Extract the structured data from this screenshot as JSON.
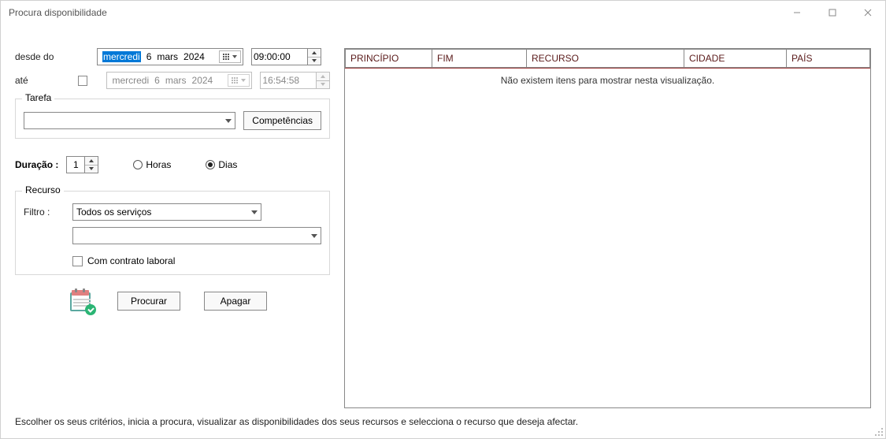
{
  "window": {
    "title": "Procura disponibilidade"
  },
  "labels": {
    "from": "desde do",
    "to": "até",
    "task_group": "Tarefa",
    "competencies_btn": "Competências",
    "duration": "Duração :",
    "hours": "Horas",
    "days": "Dias",
    "resource_group": "Recurso",
    "filter": "Filtro :",
    "contract": "Com contrato laboral",
    "search_btn": "Procurar",
    "clear_btn": "Apagar"
  },
  "date_from": {
    "weekday": "mercredi",
    "day": "6",
    "month": "mars",
    "year": "2024",
    "enabled": true
  },
  "date_to": {
    "weekday": "mercredi",
    "day": "6",
    "month": "mars",
    "year": "2024",
    "enabled": false
  },
  "time_from": "09:00:00",
  "time_to": "16:54:58",
  "to_checked": false,
  "task_value": "",
  "duration_value": "1",
  "duration_unit": "days",
  "filter_value": "Todos os serviços",
  "sub_filter_value": "",
  "contract_checked": false,
  "table": {
    "columns": [
      "PRINCÍPIO",
      "FIM",
      "RECURSO",
      "CIDADE",
      "PAÍS"
    ],
    "empty_message": "Não existem itens para mostrar nesta visualização."
  },
  "footer": "Escolher os seus critérios, inicia a procura, visualizar as disponibilidades dos seus recursos e selecciona o recurso que deseja afectar."
}
